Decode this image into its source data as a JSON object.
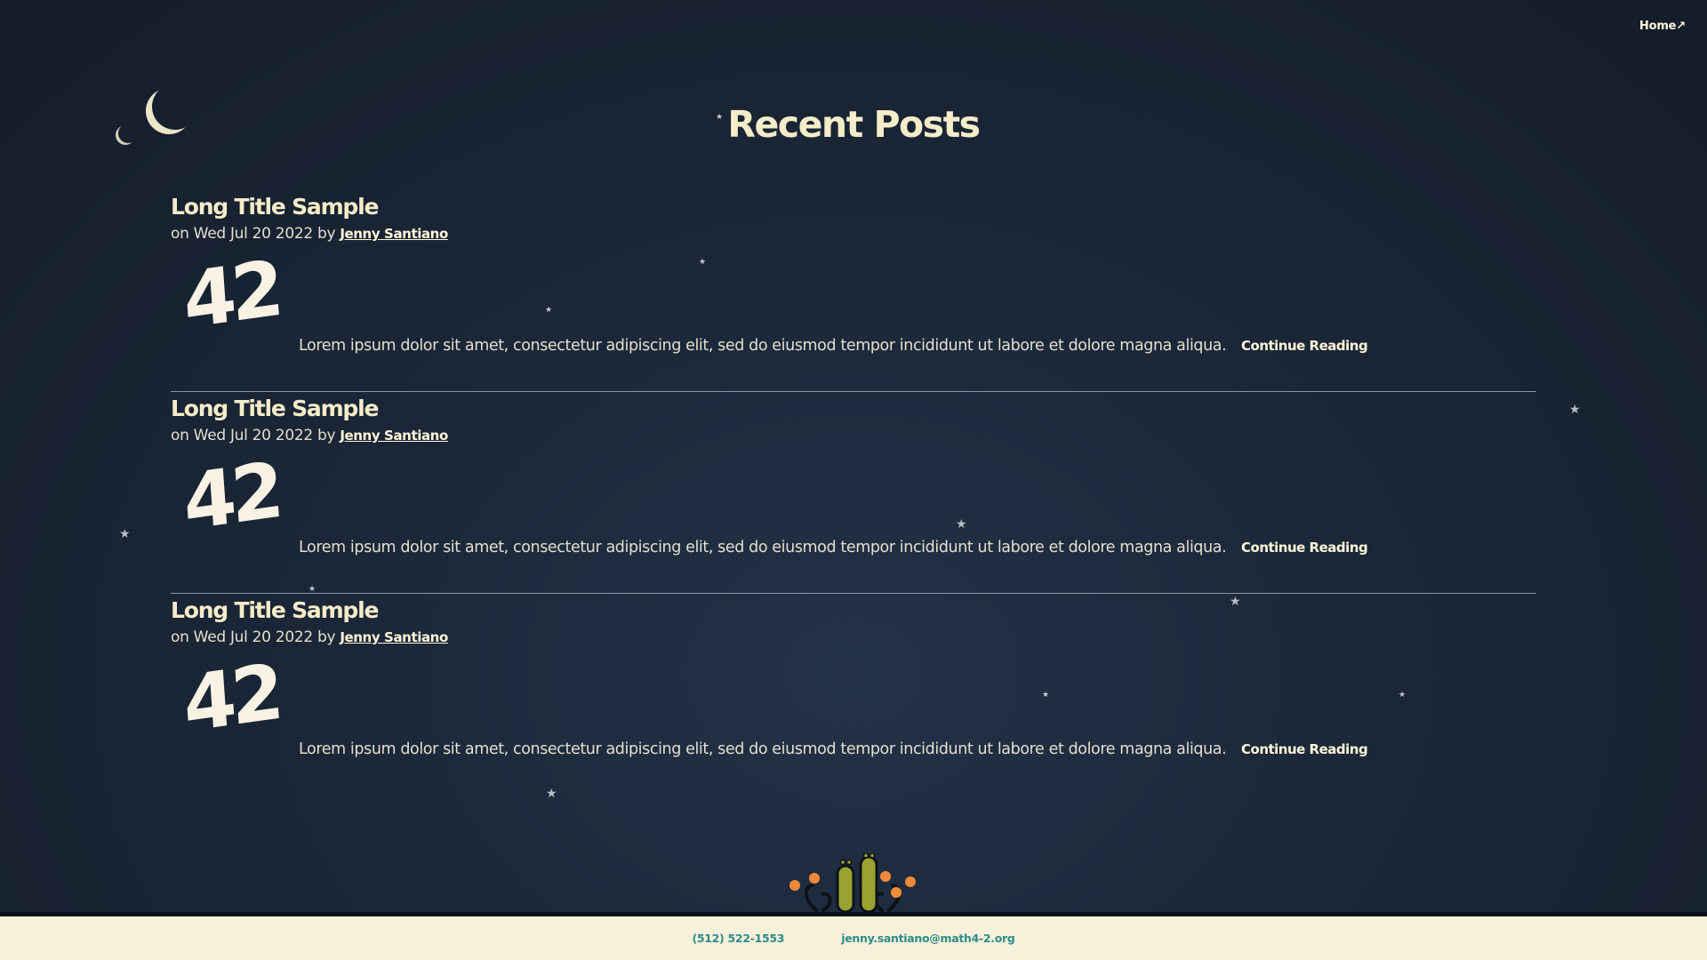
{
  "nav": {
    "home_label": "Home↗"
  },
  "page": {
    "title": "Recent Posts"
  },
  "posts": [
    {
      "title": "Long Title Sample",
      "meta_prefix": "on Wed Jul 20 2022 by ",
      "author": "Jenny Santiano",
      "badge": "42",
      "excerpt": "Lorem ipsum dolor sit amet, consectetur adipiscing elit, sed do eiusmod tempor incididunt ut labore et dolore magna aliqua.",
      "read_more": "Continue Reading"
    },
    {
      "title": "Long Title Sample",
      "meta_prefix": "on Wed Jul 20 2022 by ",
      "author": "Jenny Santiano",
      "badge": "42",
      "excerpt": "Lorem ipsum dolor sit amet, consectetur adipiscing elit, sed do eiusmod tempor incididunt ut labore et dolore magna aliqua.",
      "read_more": "Continue Reading"
    },
    {
      "title": "Long Title Sample",
      "meta_prefix": "on Wed Jul 20 2022 by ",
      "author": "Jenny Santiano",
      "badge": "42",
      "excerpt": "Lorem ipsum dolor sit amet, consectetur adipiscing elit, sed do eiusmod tempor incididunt ut labore et dolore magna aliqua.",
      "read_more": "Continue Reading"
    }
  ],
  "footer": {
    "phone": "(512) 522-1553",
    "email": "jenny.santiano@math4-2.org"
  },
  "decor": {
    "moon_icon": "crescent-moon-icon",
    "star_icon": "star-icon",
    "mascot": "alien-critters-illustration"
  },
  "colors": {
    "background": "#1b2738",
    "heading": "#f5ecc9",
    "footer_bg": "#f7f1dc",
    "footer_link": "#2e8c86"
  }
}
